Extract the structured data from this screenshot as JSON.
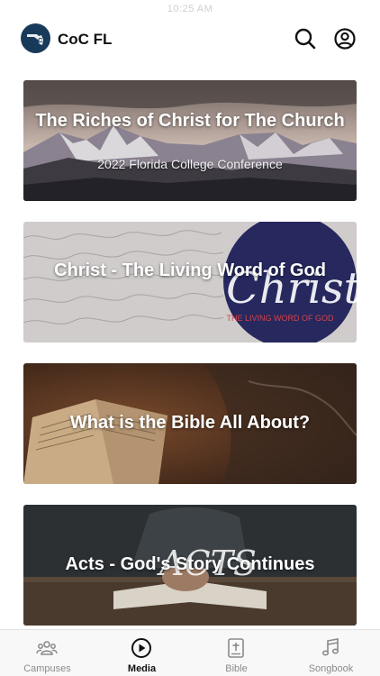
{
  "status": {
    "time": "10:25 AM"
  },
  "app": {
    "logo_text": "CoC",
    "title": "CoC FL"
  },
  "cards": [
    {
      "title": "The Riches of Christ for The Church",
      "subtitle": "2022 Florida College Conference"
    },
    {
      "title": "Christ - The Living Word of God",
      "art_word": "Christ",
      "art_caption": "THE LIVING WORD OF GOD"
    },
    {
      "title": "What is the Bible All About?"
    },
    {
      "title": "Acts - God's Story Continues",
      "art_word": "ACTS"
    }
  ],
  "tabs": [
    {
      "label": "Campuses",
      "icon": "people-icon"
    },
    {
      "label": "Media",
      "icon": "play-circle-icon",
      "active": true
    },
    {
      "label": "Bible",
      "icon": "bible-icon"
    },
    {
      "label": "Songbook",
      "icon": "music-note-icon"
    }
  ],
  "colors": {
    "logo_bg": "#183a5a",
    "circle_navy": "#26285e",
    "caption_red": "#d7424a",
    "tab_active": "#111111",
    "tab_inactive": "#8a8a8a"
  }
}
